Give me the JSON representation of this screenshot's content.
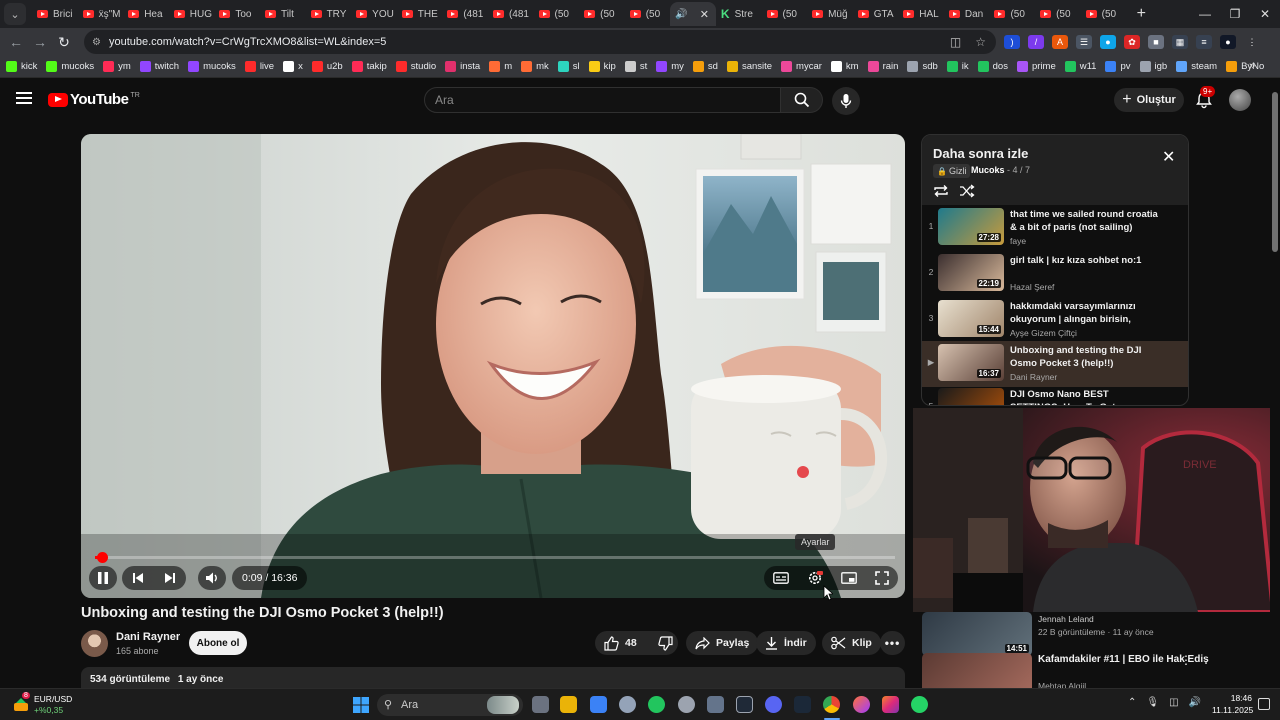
{
  "browser": {
    "tabs": [
      {
        "label": "Brici",
        "kind": "yt"
      },
      {
        "label": "ẍş\"M",
        "kind": "yt"
      },
      {
        "label": "Hea",
        "kind": "yt"
      },
      {
        "label": "HUG",
        "kind": "yt"
      },
      {
        "label": "Too",
        "kind": "yt"
      },
      {
        "label": "Tilt",
        "kind": "yt"
      },
      {
        "label": "TRY",
        "kind": "yt"
      },
      {
        "label": "YOU",
        "kind": "yt"
      },
      {
        "label": "THE",
        "kind": "yt"
      },
      {
        "label": "(481",
        "kind": "yt"
      },
      {
        "label": "(481",
        "kind": "yt"
      },
      {
        "label": "(50",
        "kind": "yt"
      },
      {
        "label": "(50",
        "kind": "yt"
      },
      {
        "label": "(50",
        "kind": "yt"
      },
      {
        "label": "",
        "kind": "active"
      },
      {
        "label": "Stre",
        "kind": "kick"
      },
      {
        "label": "(50",
        "kind": "yt"
      },
      {
        "label": "Müğ",
        "kind": "yt"
      },
      {
        "label": "GTA",
        "kind": "yt"
      },
      {
        "label": "HAL",
        "kind": "yt"
      },
      {
        "label": "Dan",
        "kind": "yt"
      },
      {
        "label": "(50",
        "kind": "yt"
      },
      {
        "label": "(50",
        "kind": "yt"
      },
      {
        "label": "(50",
        "kind": "yt"
      }
    ],
    "url": "youtube.com/watch?v=CrWgTrcXMO8&list=WL&index=5",
    "bookmarks": [
      {
        "label": "kick",
        "color": "#53fc18"
      },
      {
        "label": "mucoks",
        "color": "#53fc18"
      },
      {
        "label": "ym",
        "color": "#ff2b55"
      },
      {
        "label": "twitch",
        "color": "#9146ff"
      },
      {
        "label": "mucoks",
        "color": "#9146ff"
      },
      {
        "label": "live",
        "color": "#ff2b2b"
      },
      {
        "label": "x",
        "color": "#ffffff"
      },
      {
        "label": "u2b",
        "color": "#ff2b2b"
      },
      {
        "label": "takip",
        "color": "#ff2b55"
      },
      {
        "label": "studio",
        "color": "#ff2b2b"
      },
      {
        "label": "insta",
        "color": "#e1306c"
      },
      {
        "label": "m",
        "color": "#ff6b35"
      },
      {
        "label": "mk",
        "color": "#ff6b35"
      },
      {
        "label": "sl",
        "color": "#2dd4bf"
      },
      {
        "label": "kip",
        "color": "#facc15"
      },
      {
        "label": "st",
        "color": "#cccccc"
      },
      {
        "label": "my",
        "color": "#9146ff"
      },
      {
        "label": "sd",
        "color": "#f59e0b"
      },
      {
        "label": "sansite",
        "color": "#eab308"
      },
      {
        "label": "mycar",
        "color": "#ec4899"
      },
      {
        "label": "km",
        "color": "#ffffff"
      },
      {
        "label": "rain",
        "color": "#ec4899"
      },
      {
        "label": "sdb",
        "color": "#9ca3af"
      },
      {
        "label": "ik",
        "color": "#22c55e"
      },
      {
        "label": "dos",
        "color": "#22c55e"
      },
      {
        "label": "prime",
        "color": "#a855f7"
      },
      {
        "label": "w11",
        "color": "#22c55e"
      },
      {
        "label": "pv",
        "color": "#3b82f6"
      },
      {
        "label": "igb",
        "color": "#9ca3af"
      },
      {
        "label": "steam",
        "color": "#60a5fa"
      },
      {
        "label": "ByNo",
        "color": "#f59e0b"
      }
    ]
  },
  "youtube": {
    "logo_text": "YouTube",
    "logo_country": "TR",
    "search_placeholder": "Ara",
    "create_label": "Oluştur",
    "notifications_badge": "9+"
  },
  "player": {
    "time_display": "0:09 / 16:36",
    "progress_fraction": 0.009,
    "tooltip": "Ayarlar"
  },
  "video": {
    "title": "Unboxing and testing the DJI Osmo Pocket 3 (help!!)",
    "channel_name": "Dani Rayner",
    "subscribers": "165 abone",
    "subscribe_label": "Abone ol",
    "likes": "48",
    "share_label": "Paylaş",
    "download_label": "İndir",
    "clip_label": "Klip",
    "views": "534 görüntüleme",
    "published": "1 ay önce"
  },
  "playlist": {
    "title": "Daha sonra izle",
    "privacy": "Gizli",
    "owner": "Mucoks",
    "position": "- 4 / 7",
    "items": [
      {
        "index": "1",
        "title": "that time we sailed round croatia & a bit of paris (not sailing)",
        "channel": "faye",
        "duration": "27:28"
      },
      {
        "index": "2",
        "title": "girl talk | kız kıza sohbet no:1",
        "channel": "Hazal Şeref",
        "duration": "22:19"
      },
      {
        "index": "3",
        "title": "hakkımdaki varsayımlarınızı okuyorum | alıngan birisin, mant...",
        "channel": "Ayşe Gizem Çiftçi",
        "duration": "15:44"
      },
      {
        "index": "▶",
        "title": "Unboxing and testing the DJI Osmo Pocket 3 (help!!)",
        "channel": "Dani Rayner",
        "duration": "16:37"
      },
      {
        "index": "5",
        "title": "DJI Osmo Nano BEST SETTINGS: How To Get Cinematic Footage!",
        "channel": "",
        "duration": ""
      }
    ]
  },
  "recommended": [
    {
      "title": "",
      "channel": "Jennah Leland",
      "meta": "22 B görüntüleme · 11 ay önce",
      "duration": "14:51"
    },
    {
      "title": "Kafamdakiler #11 | EBO ile Hak Ediş",
      "channel": "Mehtap Algiil",
      "meta": "",
      "duration": ""
    }
  ],
  "taskbar": {
    "ticker_name": "EUR/USD",
    "ticker_change": "+%0,35",
    "ticker_badge": "8",
    "search_label": "Ara",
    "time": "18:46",
    "date": "11.11.2025"
  }
}
